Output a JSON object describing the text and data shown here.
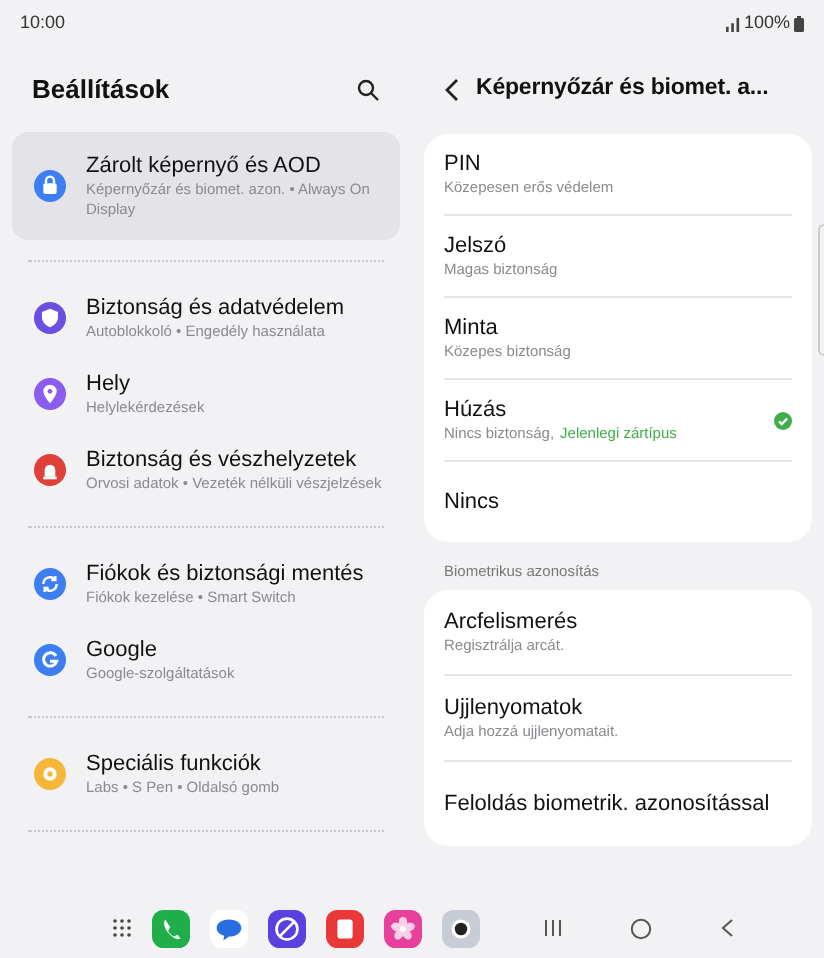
{
  "status_bar": {
    "time": "10:00",
    "battery": "100%"
  },
  "settings": {
    "title": "Beállítások",
    "groups": [
      [
        {
          "title": "Zárolt képernyő és AOD",
          "subtitle": "Képernyőzár és biomet. azon.  •  Always On Display",
          "color": "#3d7ff0",
          "selected": true
        }
      ],
      [
        {
          "title": "Biztonság és adatvédelem",
          "subtitle": "Autoblokkoló  •  Engedély használata",
          "color": "#6a4fe0",
          "selected": false
        },
        {
          "title": "Hely",
          "subtitle": "Helylekérdezések",
          "color": "#8a5cf0",
          "selected": false
        },
        {
          "title": "Biztonság és vészhelyzetek",
          "subtitle": "Orvosi adatok  •  Vezeték nélküli vészjelzések",
          "color": "#e0403a",
          "selected": false
        }
      ],
      [
        {
          "title": "Fiókok és biztonsági mentés",
          "subtitle": "Fiókok kezelése  •  Smart Switch",
          "color": "#3d7ff0",
          "selected": false
        },
        {
          "title": "Google",
          "subtitle": "Google-szolgáltatások",
          "color": "#3d7ff0",
          "selected": false
        }
      ],
      [
        {
          "title": "Speciális funkciók",
          "subtitle": "Labs  •  S Pen  •  Oldalsó gomb",
          "color": "#f5b63a",
          "selected": false
        }
      ]
    ]
  },
  "detail": {
    "title": "Képernyőzár és biomet. a...",
    "lock_types": [
      {
        "title": "PIN",
        "subtitle": "Közepesen erős védelem",
        "selected": false
      },
      {
        "title": "Jelszó",
        "subtitle": "Magas biztonság",
        "selected": false
      },
      {
        "title": "Minta",
        "subtitle": "Közepes biztonság",
        "selected": false
      },
      {
        "title": "Húzás",
        "subtitle": "Nincs biztonság,",
        "status": "Jelenlegi zártípus",
        "selected": true
      },
      {
        "title": "Nincs",
        "selected": false
      }
    ],
    "biometrics_heading": "Biometrikus azonosítás",
    "biometrics": [
      {
        "title": "Arcfelismerés",
        "subtitle": "Regisztrálja arcát."
      },
      {
        "title": "Ujjlenyomatok",
        "subtitle": "Adja hozzá ujjlenyomatait."
      },
      {
        "title": "Feloldás biometrik. azonosítással"
      }
    ]
  }
}
